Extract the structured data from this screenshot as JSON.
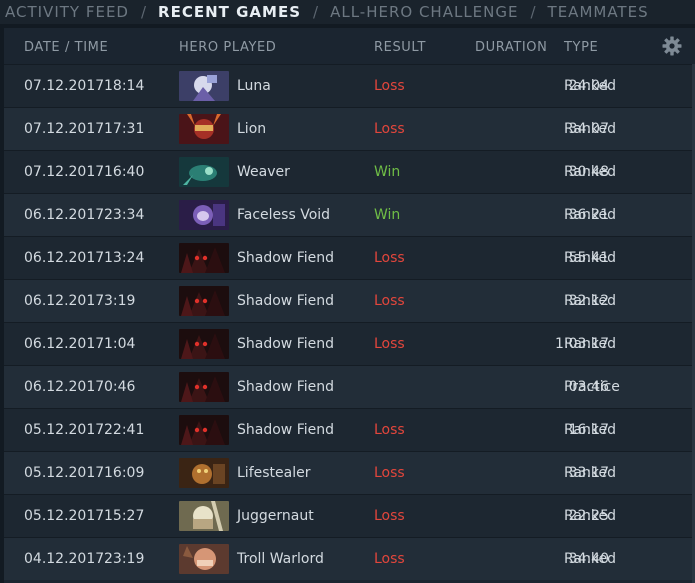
{
  "tabs": [
    "ACTIVITY FEED",
    "RECENT GAMES",
    "ALL-HERO CHALLENGE",
    "TEAMMATES"
  ],
  "tab_separator": "/",
  "columns": {
    "datetime": "DATE / TIME",
    "hero": "HERO PLAYED",
    "result": "RESULT",
    "duration": "DURATION",
    "type": "TYPE"
  },
  "settings_icon": "gear-icon",
  "colors": {
    "loss": "#e2463c",
    "win": "#6fbd46"
  },
  "matches": [
    {
      "date": "07.12.2017",
      "time": "18:14",
      "hero": "Luna",
      "portrait": "luna",
      "result": "Loss",
      "duration": "24:04",
      "type": "Ranked"
    },
    {
      "date": "07.12.2017",
      "time": "17:31",
      "hero": "Lion",
      "portrait": "lion",
      "result": "Loss",
      "duration": "34:07",
      "type": "Ranked"
    },
    {
      "date": "07.12.2017",
      "time": "16:40",
      "hero": "Weaver",
      "portrait": "weaver",
      "result": "Win",
      "duration": "30:48",
      "type": "Ranked"
    },
    {
      "date": "06.12.2017",
      "time": "23:34",
      "hero": "Faceless Void",
      "portrait": "faceless-void",
      "result": "Win",
      "duration": "36:21",
      "type": "Ranked"
    },
    {
      "date": "06.12.2017",
      "time": "13:24",
      "hero": "Shadow Fiend",
      "portrait": "shadow-fiend",
      "result": "Loss",
      "duration": "55:41",
      "type": "Ranked"
    },
    {
      "date": "06.12.2017",
      "time": "3:19",
      "hero": "Shadow Fiend",
      "portrait": "shadow-fiend",
      "result": "Loss",
      "duration": "32:12",
      "type": "Ranked"
    },
    {
      "date": "06.12.2017",
      "time": "1:04",
      "hero": "Shadow Fiend",
      "portrait": "shadow-fiend",
      "result": "Loss",
      "duration": "1:03:17",
      "type": "Ranked"
    },
    {
      "date": "06.12.2017",
      "time": "0:46",
      "hero": "Shadow Fiend",
      "portrait": "shadow-fiend",
      "result": "",
      "duration": "03:46",
      "type": "Practice"
    },
    {
      "date": "05.12.2017",
      "time": "22:41",
      "hero": "Shadow Fiend",
      "portrait": "shadow-fiend",
      "result": "Loss",
      "duration": "16:17",
      "type": "Ranked"
    },
    {
      "date": "05.12.2017",
      "time": "16:09",
      "hero": "Lifestealer",
      "portrait": "lifestealer",
      "result": "Loss",
      "duration": "33:17",
      "type": "Ranked"
    },
    {
      "date": "05.12.2017",
      "time": "15:27",
      "hero": "Juggernaut",
      "portrait": "juggernaut",
      "result": "Loss",
      "duration": "22:25",
      "type": "Ranked"
    },
    {
      "date": "04.12.2017",
      "time": "23:19",
      "hero": "Troll Warlord",
      "portrait": "troll-warlord",
      "result": "Loss",
      "duration": "34:40",
      "type": "Ranked"
    }
  ]
}
